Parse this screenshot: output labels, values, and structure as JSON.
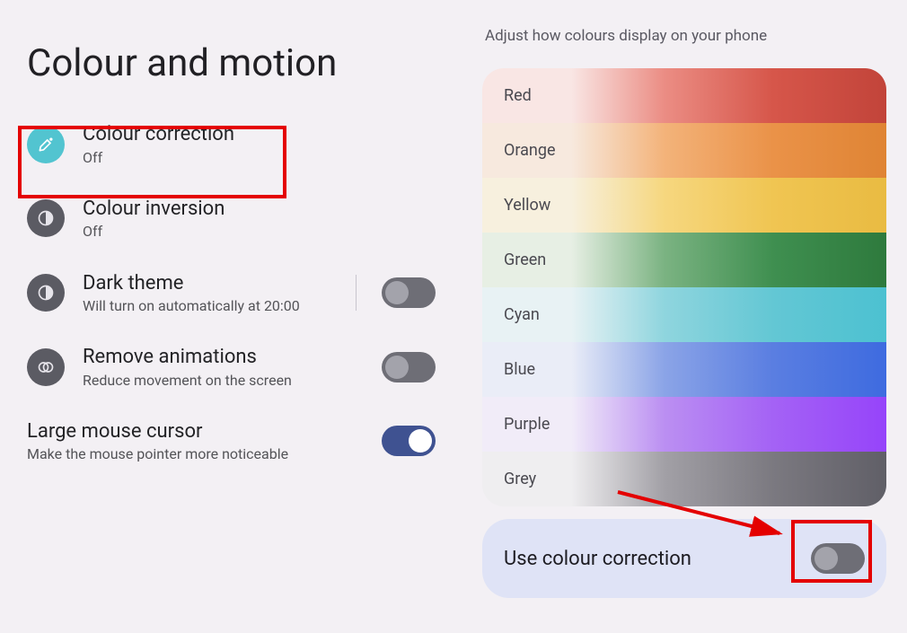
{
  "page": {
    "title": "Colour and motion"
  },
  "left": {
    "items": [
      {
        "title": "Colour correction",
        "sub": "Off",
        "icon": "eyedropper",
        "disc": "teal",
        "toggle": null
      },
      {
        "title": "Colour inversion",
        "sub": "Off",
        "icon": "half-circle",
        "disc": "grey",
        "toggle": null
      },
      {
        "title": "Dark theme",
        "sub": "Will turn on automatically at 20:00",
        "icon": "half-circle",
        "disc": "grey",
        "toggle": "off",
        "divider": true
      },
      {
        "title": "Remove animations",
        "sub": "Reduce movement on the screen",
        "icon": "double-circle",
        "disc": "grey",
        "toggle": "off"
      },
      {
        "title": "Large mouse cursor",
        "sub": "Make the mouse pointer more noticeable",
        "icon": null,
        "disc": null,
        "toggle": "on"
      }
    ]
  },
  "right": {
    "caption": "Adjust how colours display on your phone",
    "swatches": [
      {
        "label": "Red",
        "stops": [
          "#f9e6e4",
          "#eb8d84",
          "#d6564a",
          "#c2443a"
        ]
      },
      {
        "label": "Orange",
        "stops": [
          "#f7e9de",
          "#f3b37a",
          "#ea9248",
          "#df8434"
        ]
      },
      {
        "label": "Yellow",
        "stops": [
          "#f7f0de",
          "#f6d77f",
          "#f0c552",
          "#e9bb42"
        ]
      },
      {
        "label": "Green",
        "stops": [
          "#e7efe4",
          "#7bb382",
          "#3f8f50",
          "#2e7a3d"
        ]
      },
      {
        "label": "Cyan",
        "stops": [
          "#e8f2f4",
          "#8fd5de",
          "#63c7d4",
          "#4cc1d1"
        ]
      },
      {
        "label": "Blue",
        "stops": [
          "#eaedf7",
          "#8ba4e7",
          "#5a7ee1",
          "#3e6be0"
        ]
      },
      {
        "label": "Purple",
        "stops": [
          "#f1ecf8",
          "#bb8ff2",
          "#a462f5",
          "#9644fa"
        ]
      },
      {
        "label": "Grey",
        "stops": [
          "#efeef0",
          "#a2a0a6",
          "#7b7980",
          "#605f67"
        ]
      }
    ],
    "useRow": {
      "label": "Use colour correction",
      "toggle": "off"
    }
  },
  "annotations": {
    "highlighted_item_index": 0,
    "highlight_use_toggle": true
  }
}
